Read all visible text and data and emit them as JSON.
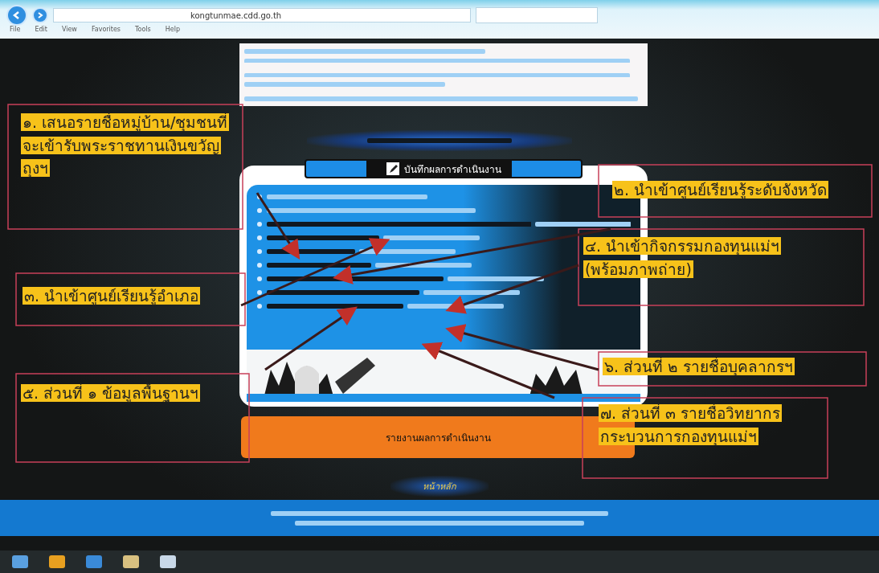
{
  "browser": {
    "address": "kongtunmae.cdd.go.th",
    "menu": [
      "File",
      "Edit",
      "View",
      "Favorites",
      "Tools",
      "Help"
    ]
  },
  "page": {
    "record_button": "บันทึกผลการดำเนินงาน",
    "report_button": "รายงานผลการดำเนินงาน",
    "home_link": "หน้าหลัก"
  },
  "annotations": [
    {
      "text": "๑. เสนอรายชื่อหมู่บ้าน/ชุมชนที่จะเข้ารับพระราชทานเงินขวัญถุงฯ"
    },
    {
      "text": "๒. นำเข้าศูนย์เรียนรู้ระดับจังหวัด"
    },
    {
      "text": "๓. นำเข้าศูนย์เรียนรู้อำเภอ"
    },
    {
      "text": "๔. นำเข้ากิจกรรมกองทุนแม่ฯ (พร้อมภาพถ่าย)"
    },
    {
      "text": "๕. ส่วนที่ ๑ ข้อมูลพื้นฐานฯ"
    },
    {
      "text": "๖. ส่วนที่ ๒ รายชื่อบุคลากรฯ"
    },
    {
      "text": "๗. ส่วนที่ ๓ รายชื่อวิทยากรกระบวนการกองทุนแม่ฯ"
    }
  ]
}
